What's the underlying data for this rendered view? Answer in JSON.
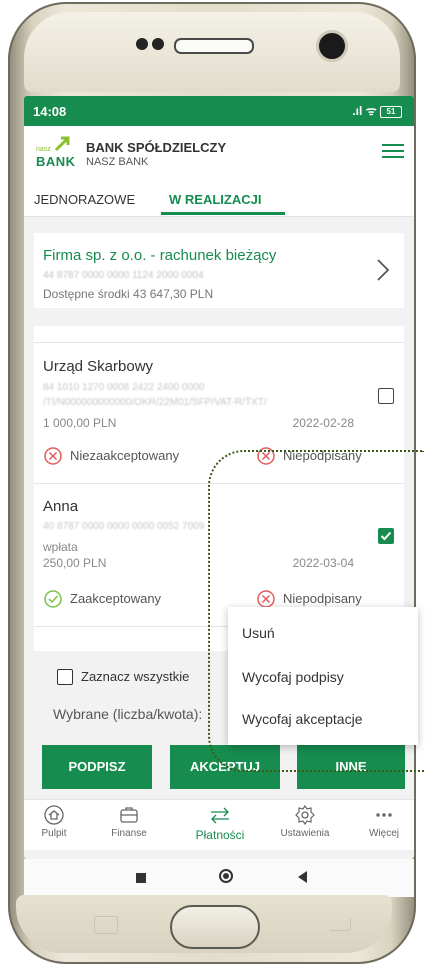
{
  "status_bar": {
    "time": "14:08",
    "signal": ".ıl",
    "wifi": "ᯤ",
    "battery": "51"
  },
  "app_bar": {
    "logo_top": "nasz",
    "logo_bottom": "BANK",
    "bank_name": "BANK SPÓŁDZIELCZY",
    "bank_subname": "NASZ BANK",
    "menu_icon": "hamburger-icon"
  },
  "tabs": [
    {
      "label": "JEDNORAZOWE",
      "active": false
    },
    {
      "label": "W REALIZACJI",
      "active": true
    }
  ],
  "account": {
    "name": "Firma sp. z o.o. - rachunek bieżący",
    "number_blurred": "44 8787 0000 0000 1124 2000 0004",
    "available": "Dostępne środki 43 647,30 PLN"
  },
  "transfers": [
    {
      "recipient": "Urząd Skarbowy",
      "account_blurred": "84 1010 1270 0008 2422 2400 0000",
      "title_blurred": "/TI/N000000000000/OKR/22M01/SFP/VAT-R/TXT/",
      "amount": "1 000,00 PLN",
      "date": "2022-02-28",
      "checked": false,
      "status_accept": "Niezaakceptowany",
      "status_sign": "Niepodpisany"
    },
    {
      "recipient": "Anna",
      "account_blurred": "40 8787 0000 0000 0000 0052 7009",
      "title": "wpłata",
      "amount": "250,00 PLN",
      "date": "2022-03-04",
      "checked": true,
      "status_accept": "Zaakceptowany",
      "status_sign": "Niepodpisany"
    }
  ],
  "bottom": {
    "select_all": "Zaznacz wszystkie",
    "selected_summary": "Wybrane (liczba/kwota):",
    "btn_sign": "PODPISZ",
    "btn_accept": "AKCEPTUJ",
    "btn_other": "INNE"
  },
  "popup_menu": [
    "Usuń",
    "Wycofaj podpisy",
    "Wycofaj akceptacje"
  ],
  "nav": [
    {
      "label": "Pulpit",
      "icon": "home-icon"
    },
    {
      "label": "Finanse",
      "icon": "wallet-icon"
    },
    {
      "label": "Płatności",
      "icon": "transfer-arrows-icon",
      "active": true
    },
    {
      "label": "Ustawienia",
      "icon": "gear-icon"
    },
    {
      "label": "Więcej",
      "icon": "more-dots-icon"
    }
  ],
  "colors": {
    "primary": "#178c4f",
    "status_ok": "#7cc04a",
    "status_bad": "#e45b5b"
  }
}
